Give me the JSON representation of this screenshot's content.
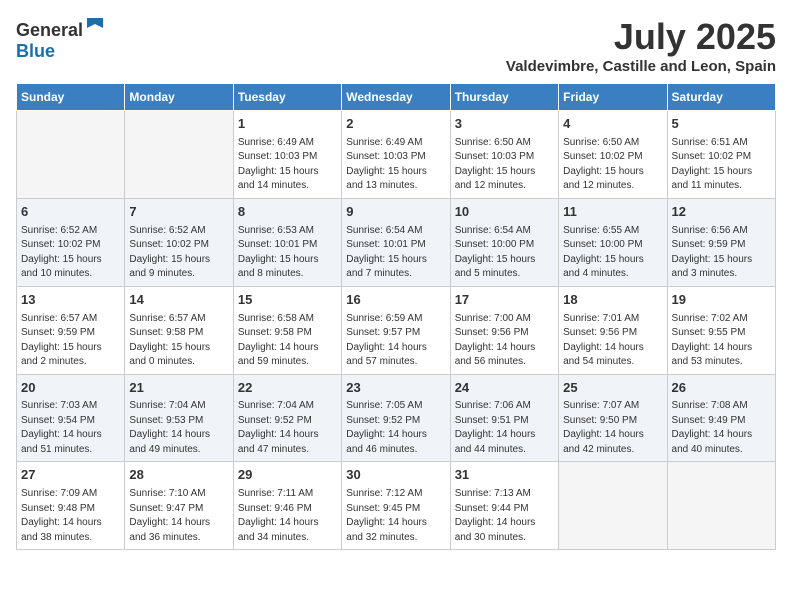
{
  "header": {
    "logo_general": "General",
    "logo_blue": "Blue",
    "month": "July 2025",
    "location": "Valdevimbre, Castille and Leon, Spain"
  },
  "calendar": {
    "weekdays": [
      "Sunday",
      "Monday",
      "Tuesday",
      "Wednesday",
      "Thursday",
      "Friday",
      "Saturday"
    ],
    "weeks": [
      [
        {
          "day": "",
          "info": ""
        },
        {
          "day": "",
          "info": ""
        },
        {
          "day": "1",
          "info": "Sunrise: 6:49 AM\nSunset: 10:03 PM\nDaylight: 15 hours and 14 minutes."
        },
        {
          "day": "2",
          "info": "Sunrise: 6:49 AM\nSunset: 10:03 PM\nDaylight: 15 hours and 13 minutes."
        },
        {
          "day": "3",
          "info": "Sunrise: 6:50 AM\nSunset: 10:03 PM\nDaylight: 15 hours and 12 minutes."
        },
        {
          "day": "4",
          "info": "Sunrise: 6:50 AM\nSunset: 10:02 PM\nDaylight: 15 hours and 12 minutes."
        },
        {
          "day": "5",
          "info": "Sunrise: 6:51 AM\nSunset: 10:02 PM\nDaylight: 15 hours and 11 minutes."
        }
      ],
      [
        {
          "day": "6",
          "info": "Sunrise: 6:52 AM\nSunset: 10:02 PM\nDaylight: 15 hours and 10 minutes."
        },
        {
          "day": "7",
          "info": "Sunrise: 6:52 AM\nSunset: 10:02 PM\nDaylight: 15 hours and 9 minutes."
        },
        {
          "day": "8",
          "info": "Sunrise: 6:53 AM\nSunset: 10:01 PM\nDaylight: 15 hours and 8 minutes."
        },
        {
          "day": "9",
          "info": "Sunrise: 6:54 AM\nSunset: 10:01 PM\nDaylight: 15 hours and 7 minutes."
        },
        {
          "day": "10",
          "info": "Sunrise: 6:54 AM\nSunset: 10:00 PM\nDaylight: 15 hours and 5 minutes."
        },
        {
          "day": "11",
          "info": "Sunrise: 6:55 AM\nSunset: 10:00 PM\nDaylight: 15 hours and 4 minutes."
        },
        {
          "day": "12",
          "info": "Sunrise: 6:56 AM\nSunset: 9:59 PM\nDaylight: 15 hours and 3 minutes."
        }
      ],
      [
        {
          "day": "13",
          "info": "Sunrise: 6:57 AM\nSunset: 9:59 PM\nDaylight: 15 hours and 2 minutes."
        },
        {
          "day": "14",
          "info": "Sunrise: 6:57 AM\nSunset: 9:58 PM\nDaylight: 15 hours and 0 minutes."
        },
        {
          "day": "15",
          "info": "Sunrise: 6:58 AM\nSunset: 9:58 PM\nDaylight: 14 hours and 59 minutes."
        },
        {
          "day": "16",
          "info": "Sunrise: 6:59 AM\nSunset: 9:57 PM\nDaylight: 14 hours and 57 minutes."
        },
        {
          "day": "17",
          "info": "Sunrise: 7:00 AM\nSunset: 9:56 PM\nDaylight: 14 hours and 56 minutes."
        },
        {
          "day": "18",
          "info": "Sunrise: 7:01 AM\nSunset: 9:56 PM\nDaylight: 14 hours and 54 minutes."
        },
        {
          "day": "19",
          "info": "Sunrise: 7:02 AM\nSunset: 9:55 PM\nDaylight: 14 hours and 53 minutes."
        }
      ],
      [
        {
          "day": "20",
          "info": "Sunrise: 7:03 AM\nSunset: 9:54 PM\nDaylight: 14 hours and 51 minutes."
        },
        {
          "day": "21",
          "info": "Sunrise: 7:04 AM\nSunset: 9:53 PM\nDaylight: 14 hours and 49 minutes."
        },
        {
          "day": "22",
          "info": "Sunrise: 7:04 AM\nSunset: 9:52 PM\nDaylight: 14 hours and 47 minutes."
        },
        {
          "day": "23",
          "info": "Sunrise: 7:05 AM\nSunset: 9:52 PM\nDaylight: 14 hours and 46 minutes."
        },
        {
          "day": "24",
          "info": "Sunrise: 7:06 AM\nSunset: 9:51 PM\nDaylight: 14 hours and 44 minutes."
        },
        {
          "day": "25",
          "info": "Sunrise: 7:07 AM\nSunset: 9:50 PM\nDaylight: 14 hours and 42 minutes."
        },
        {
          "day": "26",
          "info": "Sunrise: 7:08 AM\nSunset: 9:49 PM\nDaylight: 14 hours and 40 minutes."
        }
      ],
      [
        {
          "day": "27",
          "info": "Sunrise: 7:09 AM\nSunset: 9:48 PM\nDaylight: 14 hours and 38 minutes."
        },
        {
          "day": "28",
          "info": "Sunrise: 7:10 AM\nSunset: 9:47 PM\nDaylight: 14 hours and 36 minutes."
        },
        {
          "day": "29",
          "info": "Sunrise: 7:11 AM\nSunset: 9:46 PM\nDaylight: 14 hours and 34 minutes."
        },
        {
          "day": "30",
          "info": "Sunrise: 7:12 AM\nSunset: 9:45 PM\nDaylight: 14 hours and 32 minutes."
        },
        {
          "day": "31",
          "info": "Sunrise: 7:13 AM\nSunset: 9:44 PM\nDaylight: 14 hours and 30 minutes."
        },
        {
          "day": "",
          "info": ""
        },
        {
          "day": "",
          "info": ""
        }
      ]
    ]
  }
}
